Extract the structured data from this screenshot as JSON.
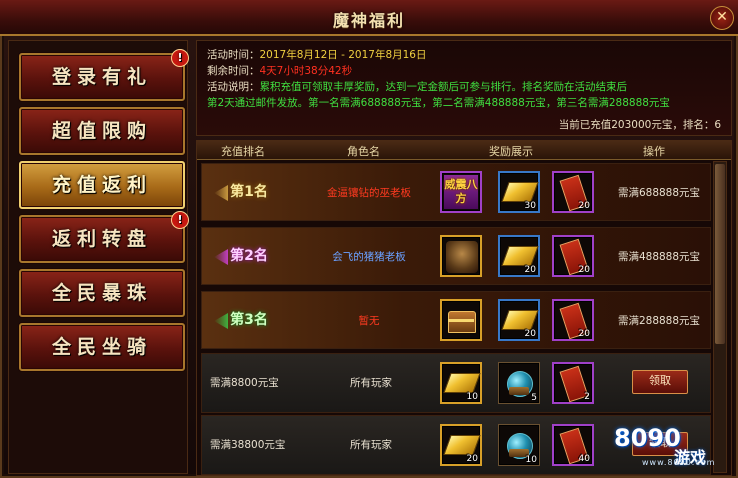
{
  "window": {
    "title": "魔神福利",
    "close_glyph": "✕"
  },
  "sidebar": {
    "items": [
      {
        "label": "登录有礼",
        "badge": "!",
        "active": false
      },
      {
        "label": "超值限购",
        "badge": "",
        "active": false
      },
      {
        "label": "充值返利",
        "badge": "",
        "active": true
      },
      {
        "label": "返利转盘",
        "badge": "!",
        "active": false
      },
      {
        "label": "全民暴珠",
        "badge": "",
        "active": false
      },
      {
        "label": "全民坐骑",
        "badge": "",
        "active": false
      }
    ]
  },
  "info": {
    "time_label": "活动时间：",
    "time_value": "2017年8月12日 - 2017年8月16日",
    "remain_label": "剩余时间：",
    "remain_value": "4天7小时38分42秒",
    "desc_label": "活动说明：",
    "desc_line1": "累积充值可领取丰厚奖励，达到一定金额后可参与排行。排名奖励在活动结束后",
    "desc_line2": "第2天通过邮件发放。第一名需满688888元宝，第二名需满488888元宝，第三名需满288888元宝",
    "current": "当前已充值203000元宝，排名：6"
  },
  "table": {
    "headers": [
      "充值排名",
      "角色名",
      "奖励展示",
      "操作"
    ],
    "rank_rows": [
      {
        "rank": "第1名",
        "name": "金逼镶钻的巫老板",
        "req": "需满688888元宝",
        "rewards": [
          {
            "icon": "title-item-icon",
            "text": "威震八方",
            "count": ""
          },
          {
            "icon": "gold-ingot-icon",
            "count": "30"
          },
          {
            "icon": "red-scroll-icon",
            "count": "20"
          }
        ]
      },
      {
        "rank": "第2名",
        "name": "会飞的猪猪老板",
        "req": "需满488888元宝",
        "rewards": [
          {
            "icon": "mount-icon",
            "count": ""
          },
          {
            "icon": "gold-ingot-icon",
            "count": "20"
          },
          {
            "icon": "red-scroll-icon",
            "count": "20"
          }
        ]
      },
      {
        "rank": "第3名",
        "name": "暂无",
        "req": "需满288888元宝",
        "rewards": [
          {
            "icon": "treasure-chest-icon",
            "count": ""
          },
          {
            "icon": "gold-ingot-icon",
            "count": "20"
          },
          {
            "icon": "red-scroll-icon",
            "count": "20"
          }
        ]
      }
    ],
    "tier_rows": [
      {
        "req": "需满8800元宝",
        "who": "所有玩家",
        "button": "领取",
        "rewards": [
          {
            "icon": "gold-ingot-icon",
            "count": "10"
          },
          {
            "icon": "crystal-orb-icon",
            "count": "5"
          },
          {
            "icon": "red-scroll-icon",
            "count": "2"
          }
        ]
      },
      {
        "req": "需满38800元宝",
        "who": "所有玩家",
        "button": "领取",
        "rewards": [
          {
            "icon": "gold-ingot-icon",
            "count": "20"
          },
          {
            "icon": "crystal-orb-icon",
            "count": "10"
          },
          {
            "icon": "red-scroll-icon",
            "count": "40"
          }
        ]
      }
    ]
  },
  "watermark": {
    "num": "8090",
    "text": "游戏",
    "url": "www.8090.com"
  },
  "colors": {
    "accent_gold": "#d8a028",
    "countdown_red": "#ff3020",
    "desc_green": "#40e040",
    "name_red": "#ff3a20"
  }
}
